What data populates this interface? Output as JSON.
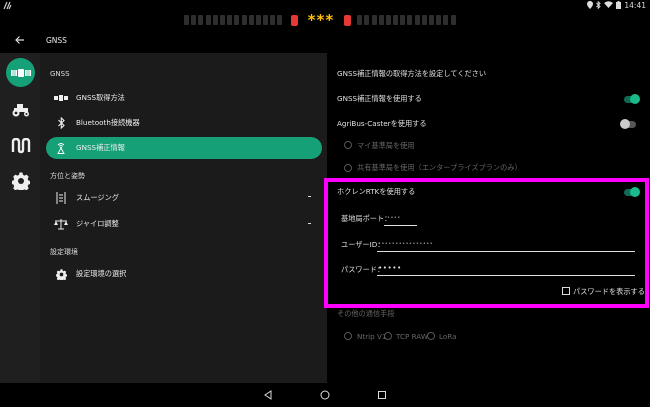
{
  "status_bar": {
    "time": "14:41"
  },
  "lightbar": {
    "indicator": "***"
  },
  "header": {
    "title": "GNSS"
  },
  "nav_rail": [
    {
      "icon": "satellite-icon",
      "active": true
    },
    {
      "icon": "tractor-icon",
      "active": false
    },
    {
      "icon": "implement-icon",
      "active": false
    },
    {
      "icon": "gear-icon",
      "active": false
    }
  ],
  "left_panel": {
    "sections": [
      {
        "header": "GNSS",
        "items": [
          "GNSS取得方法",
          "Bluetooth接続機器",
          "GNSS補正情報"
        ]
      },
      {
        "header": "方位と姿勢",
        "items": [
          "スムージング",
          "ジャイロ調整"
        ]
      },
      {
        "header": "設定環境",
        "items": [
          "設定環境の選択"
        ]
      }
    ],
    "active_item": "GNSS補正情報"
  },
  "right_panel": {
    "instruction": "GNSS補正情報の取得方法を設定してください",
    "use_correction": {
      "label": "GNSS補正情報を使用する",
      "on": true
    },
    "use_agribus": {
      "label": "AgriBus-Casterを使用する",
      "on": false
    },
    "radio_my_base": "マイ基準局を使用",
    "radio_shared_base": "共有基準局を使用（エンタープライズプランのみ）",
    "hokuren": {
      "label": "ホクレンRTKを使用する",
      "on": true,
      "port_label": "基地局ポート：",
      "port_value": "••••",
      "user_label": "ユーザーID：",
      "user_value": "••••••••••••••••",
      "password_label": "パスワード：",
      "password_value": "•••••",
      "show_password": "パスワードを表示する"
    },
    "other_methods": {
      "header": "その他の通信手段",
      "options": [
        "Ntrip V1",
        "TCP RAW",
        "LoRa"
      ]
    }
  }
}
